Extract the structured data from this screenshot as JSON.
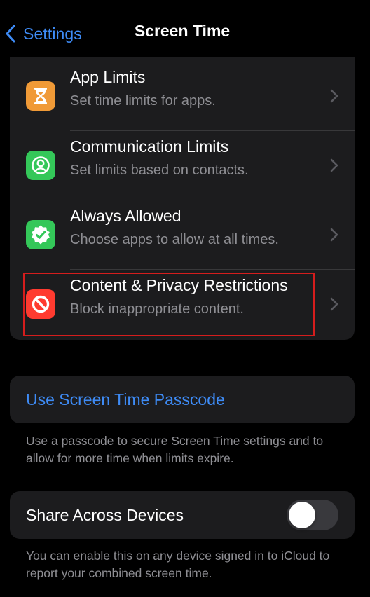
{
  "nav": {
    "back_label": "Settings",
    "title": "Screen Time"
  },
  "rows": [
    {
      "title": "App Limits",
      "subtitle": "Set time limits for apps.",
      "icon": "hourglass-icon",
      "icon_color": "#f09a37"
    },
    {
      "title": "Communication Limits",
      "subtitle": "Set limits based on contacts.",
      "icon": "person-circle-icon",
      "icon_color": "#34c759"
    },
    {
      "title": "Always Allowed",
      "subtitle": "Choose apps to allow at all times.",
      "icon": "checkmark-seal-icon",
      "icon_color": "#34c759"
    },
    {
      "title": "Content & Privacy Restrictions",
      "subtitle": "Block inappropriate content.",
      "icon": "no-entry-icon",
      "icon_color": "#ff3b30",
      "highlighted": true
    }
  ],
  "passcode": {
    "label": "Use Screen Time Passcode",
    "footnote": "Use a passcode to secure Screen Time settings and to allow for more time when limits expire."
  },
  "share": {
    "label": "Share Across Devices",
    "toggle_on": false,
    "footnote": "You can enable this on any device signed in to iCloud to report your combined screen time."
  },
  "colors": {
    "accent": "#3e8bf5",
    "background": "#000000",
    "card": "#1c1c1e",
    "secondary_text": "#8e8e93",
    "highlight_border": "#d51d1d"
  }
}
